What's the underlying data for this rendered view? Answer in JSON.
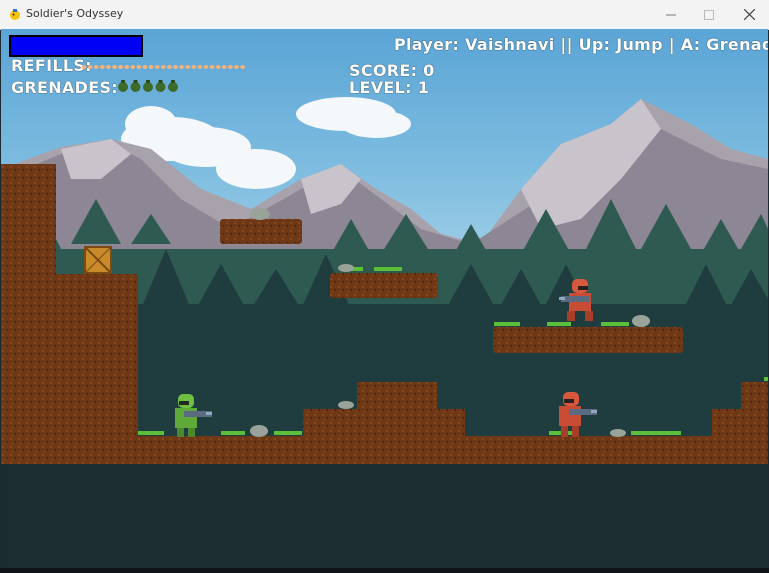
{
  "window": {
    "title": "Soldier's Odyssey"
  },
  "hud": {
    "health_fraction": 1.0,
    "refills_label": "REFILLS:",
    "refills_count": 27,
    "grenades_label": "GRENADES:",
    "grenades_count": 5,
    "score_text": "SCORE: 0",
    "level_text": "LEVEL: 1",
    "controls_text": "Player: Vaishnavi || Up: Jump | A: Grenade | -"
  },
  "colors": {
    "health": "#0000f5",
    "sky": "#5fa8d4",
    "dirt": "#6b3516",
    "grass": "#5bbf3a",
    "player": "#6fbf45",
    "enemy": "#d8583e"
  },
  "icons": [
    "app-icon",
    "minimize-icon",
    "maximize-icon",
    "close-icon",
    "grenade-icon",
    "ammo-icon"
  ]
}
